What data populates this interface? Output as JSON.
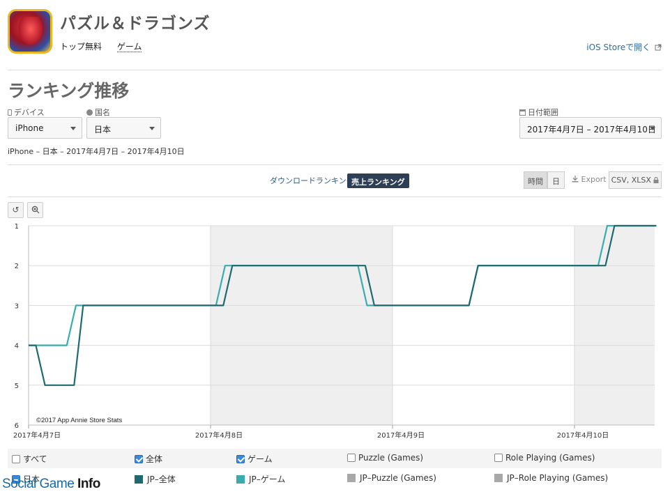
{
  "app": {
    "title": "パズル＆ドラゴンズ",
    "category": "トップ無料",
    "genre": "ゲーム",
    "store_link": "iOS Storeで開く"
  },
  "section_title": "ランキング推移",
  "filters": {
    "device_label": "デバイス",
    "device_value": "iPhone",
    "country_label": "国名",
    "country_value": "日本",
    "date_label": "日付範囲",
    "date_value": "2017年4月7日 – 2017年4月10日"
  },
  "summary": "iPhone – 日本 – 2017年4月7日 – 2017年4月10日",
  "tabs": {
    "download": "ダウンロードランキング",
    "sales": "売上ランキング"
  },
  "toolbar": {
    "hour": "時間",
    "day": "日",
    "export": "Export",
    "formats": "CSV, XLSX"
  },
  "chart_data": {
    "type": "line",
    "x_ticks": [
      "2017年4月7日",
      "2017年4月8日",
      "2017年4月9日",
      "2017年4月10日"
    ],
    "y_ticks": [
      "1",
      "2",
      "3",
      "4",
      "5",
      "6"
    ],
    "ylim": [
      1,
      6
    ],
    "y_inverted": true,
    "xlim": [
      0,
      3.45
    ],
    "credit": "©2017 App Annie Store Stats",
    "series": [
      {
        "name": "JP-全体",
        "color": "#1f6a6e",
        "points": [
          [
            0,
            4
          ],
          [
            0.04,
            4
          ],
          [
            0.09,
            5
          ],
          [
            0.25,
            5
          ],
          [
            0.3,
            3
          ],
          [
            1.07,
            3
          ],
          [
            1.12,
            2
          ],
          [
            1.85,
            2
          ],
          [
            1.9,
            3
          ],
          [
            2.42,
            3
          ],
          [
            2.47,
            2
          ],
          [
            3.17,
            2
          ],
          [
            3.22,
            1
          ],
          [
            3.45,
            1
          ]
        ]
      },
      {
        "name": "JP-ゲーム",
        "color": "#3aacb0",
        "points": [
          [
            0,
            4
          ],
          [
            0.21,
            4
          ],
          [
            0.26,
            3
          ],
          [
            1.03,
            3
          ],
          [
            1.08,
            2
          ],
          [
            1.81,
            2
          ],
          [
            1.86,
            3
          ],
          [
            2.42,
            3
          ],
          [
            2.47,
            2
          ],
          [
            3.13,
            2
          ],
          [
            3.18,
            1
          ],
          [
            3.45,
            1
          ]
        ]
      }
    ]
  },
  "legend": {
    "all": "すべて",
    "total": "全体",
    "game": "ゲーム",
    "puzzle": "Puzzle (Games)",
    "rpg": "Role Playing (Games)",
    "country": "日本",
    "jp_total": "JP–全体",
    "jp_game": "JP–ゲーム",
    "jp_puzzle": "JP–Puzzle (Games)",
    "jp_rpg": "JP–Role Playing (Games)",
    "grey": "#a8a8a8"
  },
  "watermark": {
    "part1": "Social Game ",
    "part2": "Info"
  }
}
